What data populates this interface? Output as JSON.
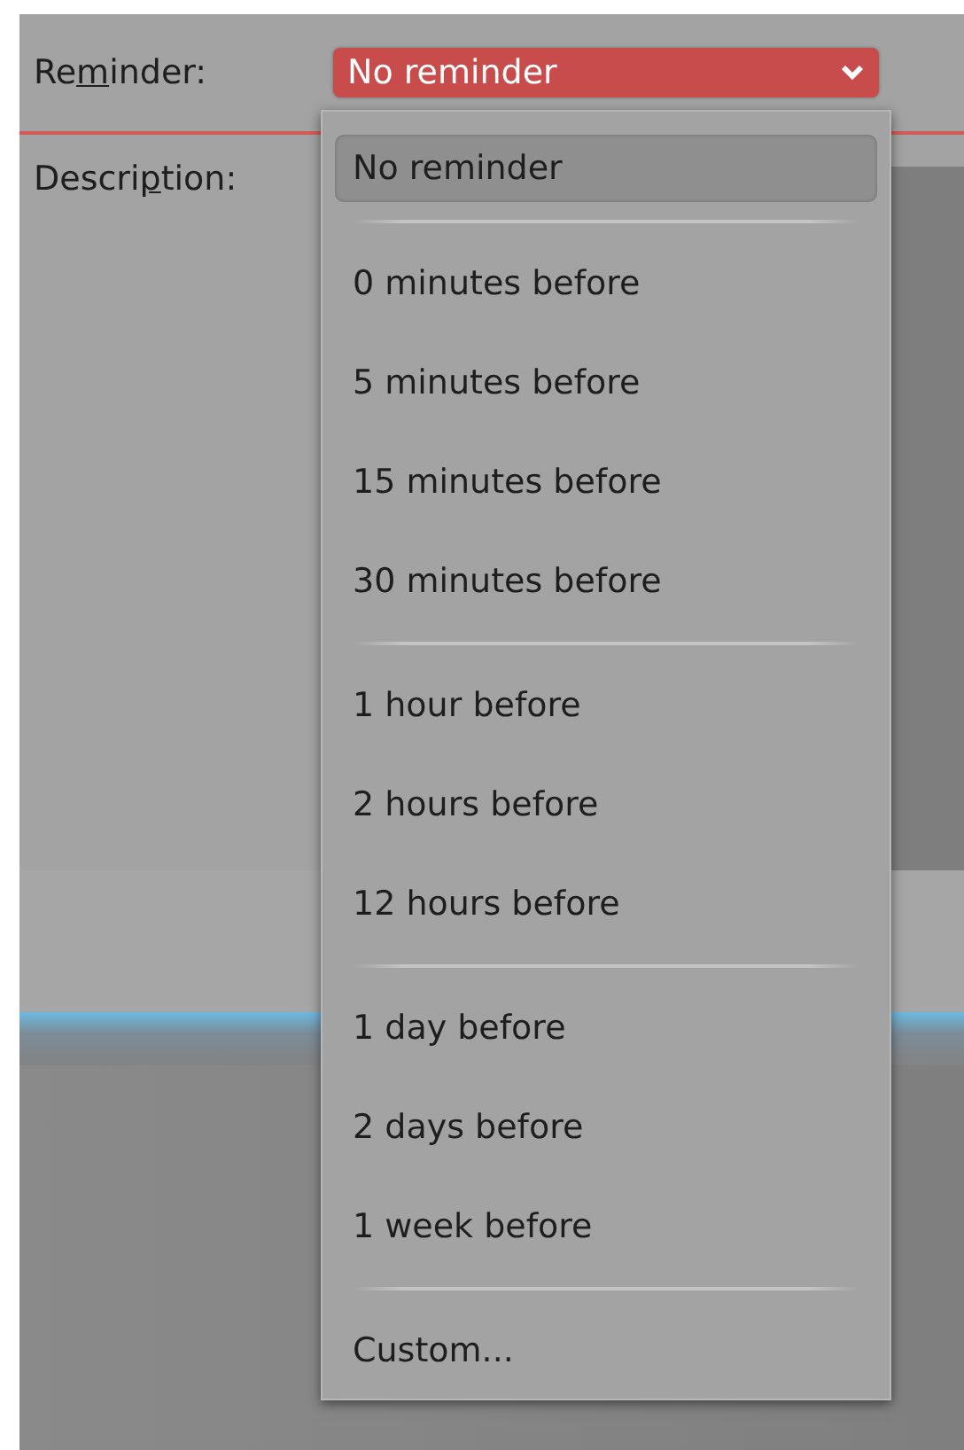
{
  "reminder": {
    "label": {
      "before": "Re",
      "mnemonic": "m",
      "after": "inder:"
    },
    "value": "No reminder"
  },
  "description": {
    "label": {
      "before": "Descri",
      "mnemonic": "p",
      "after": "tion:"
    }
  },
  "menu": {
    "items": [
      {
        "kind": "option",
        "label": "No reminder",
        "selected": true
      },
      {
        "kind": "separator"
      },
      {
        "kind": "option",
        "label": "0 minutes before",
        "selected": false
      },
      {
        "kind": "option",
        "label": "5 minutes before",
        "selected": false
      },
      {
        "kind": "option",
        "label": "15 minutes before",
        "selected": false
      },
      {
        "kind": "option",
        "label": "30 minutes before",
        "selected": false
      },
      {
        "kind": "separator"
      },
      {
        "kind": "option",
        "label": "1 hour before",
        "selected": false
      },
      {
        "kind": "option",
        "label": "2 hours before",
        "selected": false
      },
      {
        "kind": "option",
        "label": "12 hours before",
        "selected": false
      },
      {
        "kind": "separator"
      },
      {
        "kind": "option",
        "label": "1 day before",
        "selected": false
      },
      {
        "kind": "option",
        "label": "2 days before",
        "selected": false
      },
      {
        "kind": "option",
        "label": "1 week before",
        "selected": false
      },
      {
        "kind": "separator"
      },
      {
        "kind": "option",
        "label": "Custom...",
        "selected": false
      }
    ]
  }
}
